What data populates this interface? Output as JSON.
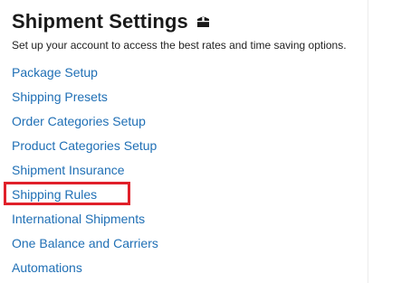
{
  "header": {
    "title": "Shipment Settings",
    "icon": "package-icon",
    "subtitle": "Set up your account to access the best rates and time saving options."
  },
  "nav": {
    "items": [
      {
        "label": "Package Setup"
      },
      {
        "label": "Shipping Presets"
      },
      {
        "label": "Order Categories Setup"
      },
      {
        "label": "Product Categories Setup"
      },
      {
        "label": "Shipment Insurance"
      },
      {
        "label": "Shipping Rules"
      },
      {
        "label": "International Shipments"
      },
      {
        "label": "One Balance and Carriers"
      },
      {
        "label": "Automations"
      }
    ]
  },
  "colors": {
    "link": "#1f6fb5",
    "title": "#1a1a1a",
    "highlight": "#e0202a"
  }
}
